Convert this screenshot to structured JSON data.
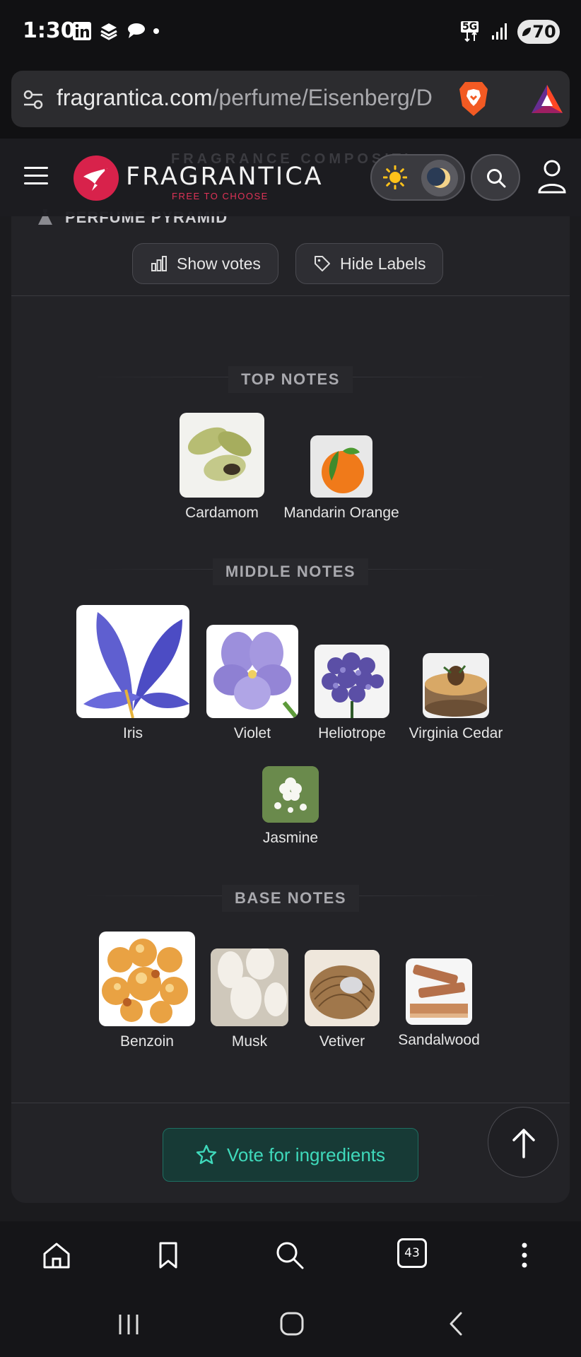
{
  "status_bar": {
    "time": "1:30",
    "network": "5G",
    "battery": "70"
  },
  "url_bar": {
    "domain": "fragrantica.com",
    "path": "/perfume/Eisenberg/D"
  },
  "header": {
    "ghost_title": "FRAGRANCE COMPOSITI",
    "brand_name": "FRAGRANTICA",
    "brand_tagline": "FREE TO CHOOSE"
  },
  "section": {
    "title": "PERFUME PYRAMID",
    "show_votes_label": "Show votes",
    "hide_labels_label": "Hide Labels"
  },
  "pyramid": {
    "top": {
      "label": "TOP NOTES",
      "notes": [
        "Cardamom",
        "Mandarin Orange"
      ]
    },
    "middle": {
      "label": "MIDDLE NOTES",
      "notes": [
        "Iris",
        "Violet",
        "Heliotrope",
        "Virginia Cedar",
        "Jasmine"
      ]
    },
    "base": {
      "label": "BASE NOTES",
      "notes": [
        "Benzoin",
        "Musk",
        "Vetiver",
        "Sandalwood"
      ]
    }
  },
  "vote_button_label": "Vote for ingredients",
  "bottom_bar": {
    "tabs_count": "43"
  },
  "colors": {
    "accent": "#3fd9bb",
    "brand": "#d8224b",
    "background": "#1b1b1e"
  }
}
